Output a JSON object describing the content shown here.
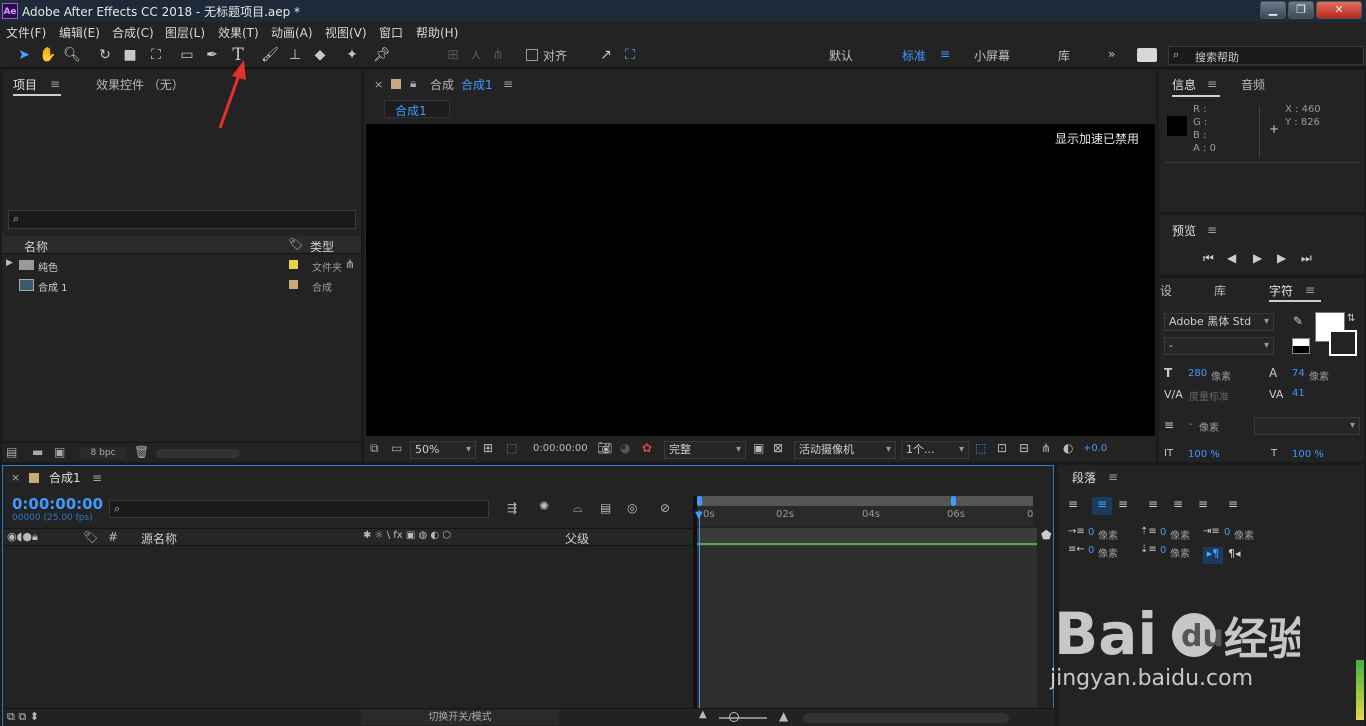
{
  "window": {
    "app_icon": "Ae",
    "title": "Adobe After Effects CC 2018 - 无标题项目.aep *"
  },
  "menu": [
    "文件(F)",
    "编辑(E)",
    "合成(C)",
    "图层(L)",
    "效果(T)",
    "动画(A)",
    "视图(V)",
    "窗口",
    "帮助(H)"
  ],
  "toolbar": {
    "align_label": "对齐",
    "workspaces": [
      "默认",
      "标准",
      "小屏幕",
      "库"
    ],
    "search_placeholder": "搜索帮助"
  },
  "project_panel": {
    "tabs": [
      "项目",
      "效果控件 （无）"
    ],
    "columns": {
      "name": "名称",
      "type": "类型"
    },
    "items": [
      {
        "name": "纯色",
        "type": "文件夹",
        "label_color": "#e8d44a"
      },
      {
        "name": "合成 1",
        "type": "合成",
        "label_color": "#c8aa7a"
      }
    ],
    "bpc": "8 bpc"
  },
  "comp_panel": {
    "header": "合成",
    "comp_name": "合成1",
    "subtab": "合成1",
    "accel_text": "显示加速已禁用",
    "zoom": "50%",
    "timecode": "0:00:00:00",
    "resolution": "完整",
    "camera": "活动摄像机",
    "views": "1个...",
    "exposure": "+0.0"
  },
  "info_panel": {
    "tabs": [
      "信息",
      "音频"
    ],
    "r": "R :",
    "g": "G :",
    "b": "B :",
    "a": "A : 0",
    "x": "X : 460",
    "y": "Y : 826"
  },
  "preview_panel": {
    "title": "预览"
  },
  "character_panel": {
    "tabs": [
      "设",
      "库",
      "字符"
    ],
    "font": "Adobe 黑体 Std",
    "style": "-",
    "size_value": "280",
    "size_unit": "像素",
    "leading_value": "74",
    "leading_unit": "像素",
    "kerning": "度量标准",
    "tracking": "41",
    "stroke_value": "-",
    "stroke_unit": "像素",
    "scale_v": "100 %",
    "scale_h": "100 %"
  },
  "paragraph_panel": {
    "title": "段落",
    "indent_value": "0",
    "indent_unit": "像素"
  },
  "timeline": {
    "comp_name": "合成1",
    "timecode": "0:00:00:00",
    "frames": "00000 (25.00 fps)",
    "col_hash": "#",
    "col_source": "源名称",
    "col_parent": "父级",
    "ruler": [
      "0s",
      "02s",
      "04s",
      "06s",
      "0"
    ],
    "toggle_label": "切换开关/模式"
  },
  "watermark": {
    "url": "jingyan.baidu.com"
  },
  "colors": {
    "accent": "#3d9bff",
    "panel": "#232323",
    "bg": "#1a1a1a",
    "viewer": "#000000"
  }
}
